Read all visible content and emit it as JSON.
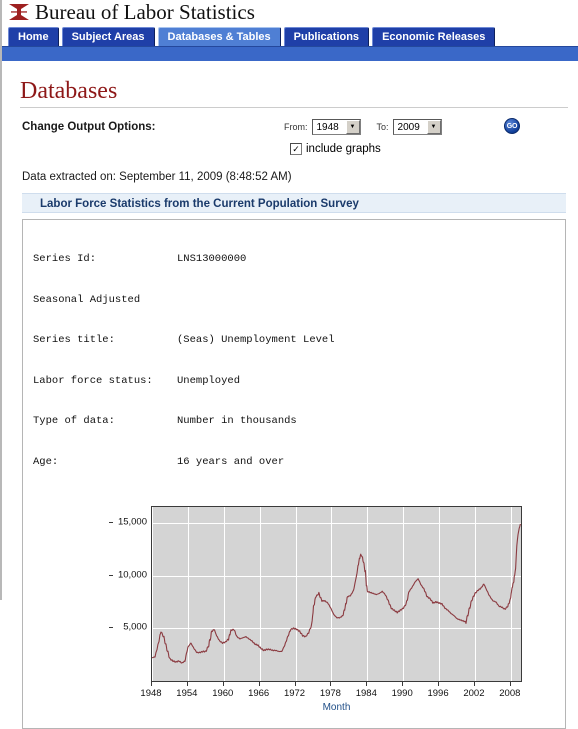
{
  "masthead": {
    "agency": "Bureau of Labor Statistics",
    "logo_icon": "bls-mark-icon",
    "logo_color": "#9e2020"
  },
  "nav": {
    "tabs": [
      {
        "label": "Home",
        "active": false
      },
      {
        "label": "Subject Areas",
        "active": false
      },
      {
        "label": "Databases & Tables",
        "active": true
      },
      {
        "label": "Publications",
        "active": false
      },
      {
        "label": "Economic Releases",
        "active": false
      }
    ],
    "active_color": "#4f7fd4",
    "inactive_color": "#1f3fa8"
  },
  "page": {
    "title": "Databases",
    "title_color": "#8e1818"
  },
  "options": {
    "label": "Change Output Options:",
    "from_label": "From:",
    "from_value": "1948",
    "to_label": "To:",
    "to_value": "2009",
    "go_label": "GO",
    "go_icon": "go-button-icon",
    "dropdown_icon": "chevron-down-icon",
    "include_graphs_label": "include graphs",
    "include_graphs_checked": true,
    "checkbox_icon": "checkmark-icon"
  },
  "extracted": {
    "text": "Data extracted on: September 11, 2009 (8:48:52 AM)"
  },
  "survey": {
    "heading": "Labor Force Statistics from the Current Population Survey"
  },
  "series": {
    "rows": [
      {
        "key": "Series Id:",
        "value": "LNS13000000"
      },
      {
        "key": "Seasonal Adjusted",
        "value": ""
      },
      {
        "key": "Series title:",
        "value": "(Seas) Unemployment Level"
      },
      {
        "key": "Labor force status:",
        "value": "Unemployed"
      },
      {
        "key": "Type of data:",
        "value": "Number in thousands"
      },
      {
        "key": "Age:",
        "value": "16 years and over"
      }
    ]
  },
  "chart_data": {
    "type": "line",
    "title": "",
    "xlabel": "Month",
    "ylabel": "",
    "line_color": "#8b3a40",
    "plot_bg": "#d4d4d4",
    "grid": true,
    "xlim": [
      1948,
      2009.7
    ],
    "ylim": [
      0,
      16500
    ],
    "xticks": [
      1948,
      1954,
      1960,
      1966,
      1972,
      1978,
      1984,
      1990,
      1996,
      2002,
      2008
    ],
    "yticks": [
      5000,
      10000,
      15000
    ],
    "ytick_labels": [
      "5,000",
      "10,000",
      "15,000"
    ],
    "series_name": "(Seas) Unemployment Level",
    "units": "Number in thousands",
    "x": [
      1948.0,
      1948.5,
      1949.0,
      1949.5,
      1950.0,
      1950.5,
      1951.0,
      1951.5,
      1952.0,
      1952.5,
      1953.0,
      1953.5,
      1954.0,
      1954.5,
      1955.0,
      1955.5,
      1956.0,
      1956.5,
      1957.0,
      1957.5,
      1958.0,
      1958.4,
      1958.8,
      1959.3,
      1959.8,
      1960.3,
      1960.8,
      1961.2,
      1961.7,
      1962.2,
      1962.7,
      1963.2,
      1963.7,
      1964.2,
      1964.7,
      1965.2,
      1965.7,
      1966.2,
      1966.7,
      1967.2,
      1967.7,
      1968.2,
      1968.7,
      1969.2,
      1969.7,
      1970.2,
      1970.7,
      1971.2,
      1971.7,
      1972.2,
      1972.7,
      1973.2,
      1973.7,
      1974.2,
      1974.7,
      1975.0,
      1975.4,
      1975.9,
      1976.4,
      1976.9,
      1977.4,
      1977.9,
      1978.4,
      1978.9,
      1979.4,
      1979.9,
      1980.3,
      1980.7,
      1981.2,
      1981.7,
      1982.2,
      1982.6,
      1982.9,
      1983.2,
      1983.6,
      1984.0,
      1984.5,
      1985.0,
      1985.5,
      1986.0,
      1986.5,
      1987.0,
      1987.5,
      1988.0,
      1988.5,
      1989.0,
      1989.5,
      1990.0,
      1990.5,
      1991.0,
      1991.5,
      1992.0,
      1992.5,
      1993.0,
      1993.5,
      1994.0,
      1994.5,
      1995.0,
      1995.5,
      1996.0,
      1996.5,
      1997.0,
      1997.5,
      1998.0,
      1998.5,
      1999.0,
      1999.5,
      2000.0,
      2000.5,
      2001.0,
      2001.5,
      2002.0,
      2002.5,
      2003.0,
      2003.5,
      2003.9,
      2004.4,
      2005.0,
      2005.5,
      2006.0,
      2006.5,
      2007.0,
      2007.5,
      2007.9,
      2008.2,
      2008.5,
      2008.8,
      2009.0,
      2009.2,
      2009.4,
      2009.6
    ],
    "y": [
      2200,
      2300,
      3400,
      4700,
      4100,
      3000,
      2100,
      1900,
      1800,
      1900,
      1700,
      1900,
      3200,
      3600,
      3100,
      2700,
      2700,
      2800,
      2800,
      3400,
      4700,
      4900,
      4300,
      3800,
      3600,
      3700,
      4000,
      4800,
      4900,
      4200,
      4000,
      4100,
      4200,
      4000,
      3800,
      3500,
      3400,
      3100,
      2900,
      3000,
      3000,
      2900,
      2900,
      2800,
      2800,
      3400,
      4200,
      4900,
      5000,
      4900,
      4700,
      4300,
      4200,
      4600,
      5300,
      7000,
      8000,
      8300,
      7600,
      7600,
      7400,
      6900,
      6300,
      6000,
      6000,
      6200,
      7000,
      8000,
      8100,
      8600,
      10000,
      11400,
      12000,
      11700,
      10600,
      8500,
      8400,
      8300,
      8200,
      8300,
      8500,
      8200,
      7600,
      6900,
      6700,
      6500,
      6700,
      6900,
      7300,
      8500,
      8900,
      9400,
      9700,
      9100,
      8700,
      8000,
      7800,
      7400,
      7500,
      7400,
      7300,
      6900,
      6700,
      6400,
      6200,
      5900,
      5800,
      5700,
      5600,
      6700,
      7700,
      8300,
      8600,
      8800,
      9200,
      8700,
      8100,
      7600,
      7500,
      7100,
      7000,
      6800,
      7100,
      7700,
      8800,
      9500,
      10700,
      12700,
      13800,
      14500,
      14900
    ]
  }
}
